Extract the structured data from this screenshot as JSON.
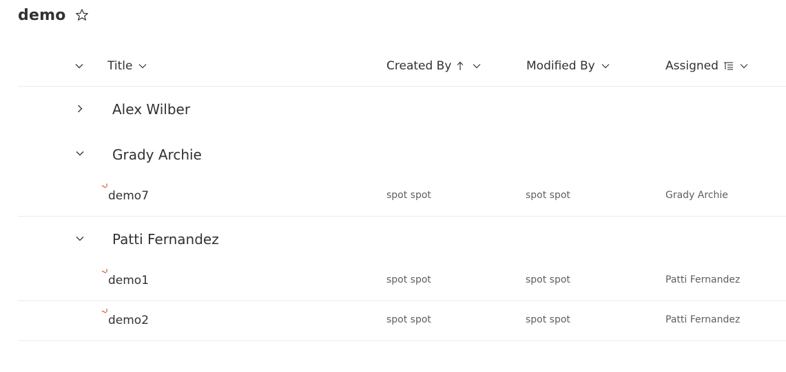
{
  "page": {
    "title": "demo",
    "favorite_icon": "star-outline-icon"
  },
  "columns": {
    "title": "Title",
    "created_by": "Created By",
    "modified_by": "Modified By",
    "assigned": "Assigned",
    "created_by_sort": "ascending"
  },
  "groups": [
    {
      "name": "Alex Wilber",
      "expanded": false,
      "items": []
    },
    {
      "name": "Grady Archie",
      "expanded": true,
      "items": [
        {
          "title": "demo7",
          "created_by": "spot spot",
          "modified_by": "spot spot",
          "assigned": "Grady Archie"
        }
      ]
    },
    {
      "name": "Patti Fernandez",
      "expanded": true,
      "items": [
        {
          "title": "demo1",
          "created_by": "spot spot",
          "modified_by": "spot spot",
          "assigned": "Patti Fernandez"
        },
        {
          "title": "demo2",
          "created_by": "spot spot",
          "modified_by": "spot spot",
          "assigned": "Patti Fernandez"
        }
      ]
    }
  ],
  "colors": {
    "text": "#323130",
    "secondary_text": "#605e5c",
    "divider": "#edebe9",
    "new_indicator": "#c4501b"
  }
}
